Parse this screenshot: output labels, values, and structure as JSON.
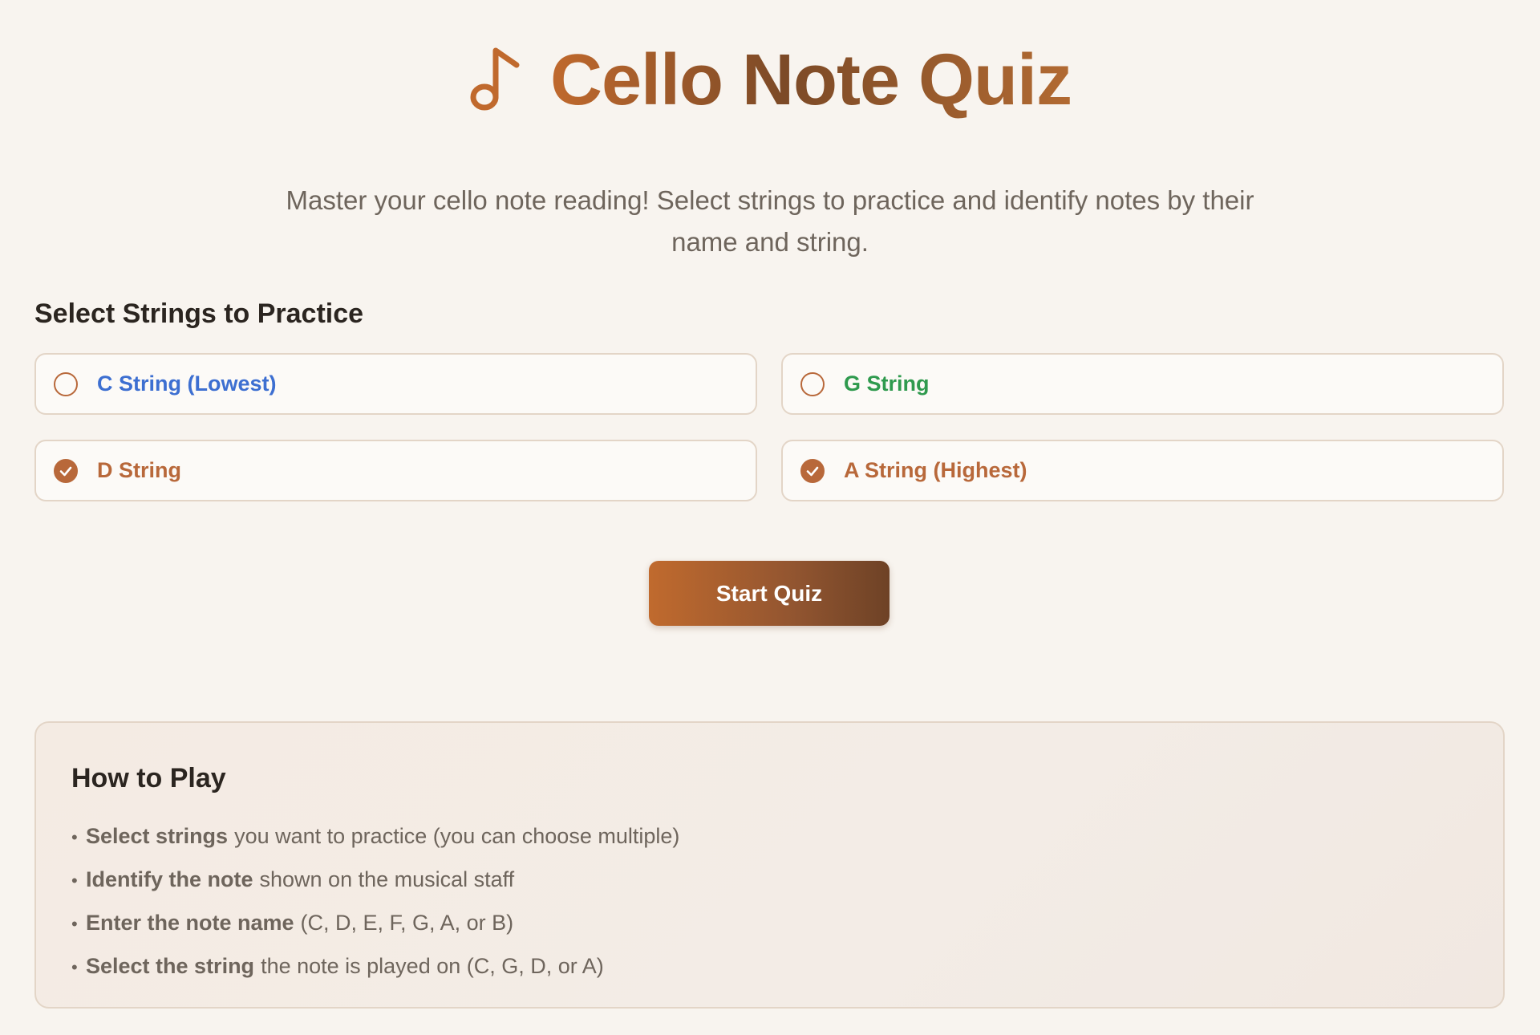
{
  "header": {
    "icon": "music-note-icon",
    "title": "Cello Note Quiz",
    "subtitle": "Master your cello note reading! Select strings to practice and identify notes by their name and string.",
    "title_gradient": [
      "#c0692d",
      "#7c4a27",
      "#b26a32"
    ]
  },
  "strings_section": {
    "title": "Select Strings to Practice",
    "options": [
      {
        "label": "C String (Lowest)",
        "checked": false,
        "color": "#3d6fd1"
      },
      {
        "label": "G String",
        "checked": false,
        "color": "#2f9a4e"
      },
      {
        "label": "D String",
        "checked": true,
        "color": "#b8683a"
      },
      {
        "label": "A String (Highest)",
        "checked": true,
        "color": "#b8683a"
      }
    ]
  },
  "start_button": {
    "label": "Start Quiz"
  },
  "how_to_play": {
    "title": "How to Play",
    "items": [
      {
        "bold": "Select strings",
        "rest": "you want to practice (you can choose multiple)"
      },
      {
        "bold": "Identify the note",
        "rest": "shown on the musical staff"
      },
      {
        "bold": "Enter the note name",
        "rest": "(C, D, E, F, G, A, or B)"
      },
      {
        "bold": "Select the string",
        "rest": "the note is played on (C, G, D, or A)"
      }
    ]
  },
  "colors": {
    "accent": "#b8683a",
    "background": "#f8f4ef",
    "border": "#e3d5c7",
    "muted_text": "#6e655c"
  }
}
